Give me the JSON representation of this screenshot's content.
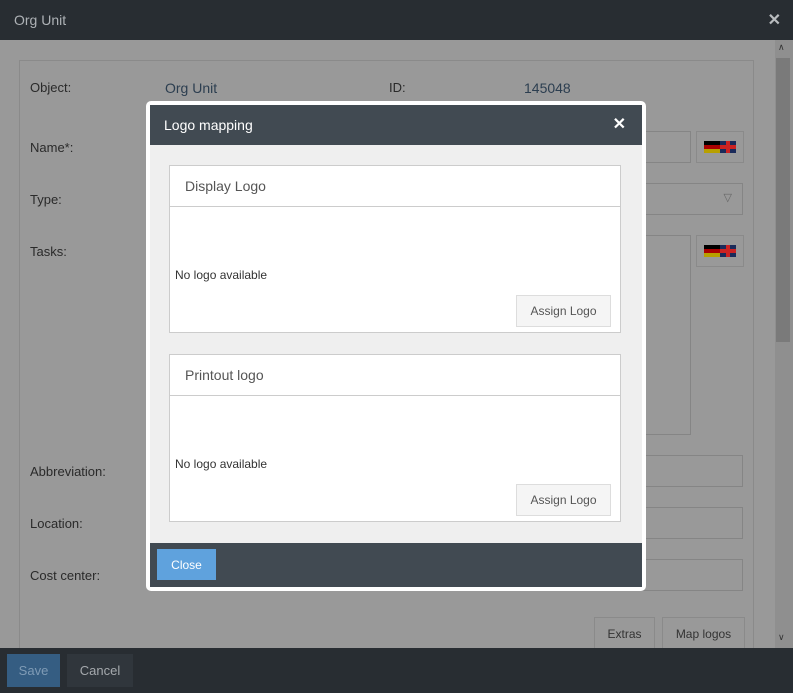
{
  "window": {
    "title": "Org Unit",
    "close_icon": "✕"
  },
  "form": {
    "object_label": "Object:",
    "object_value": "Org Unit",
    "id_label": "ID:",
    "id_value": "145048",
    "name_label": "Name*:",
    "type_label": "Type:",
    "tasks_label": "Tasks:",
    "abbreviation_label": "Abbreviation:",
    "location_label": "Location:",
    "cost_center_label": "Cost center:",
    "extras_label": "Extras",
    "map_logos_label": "Map logos"
  },
  "footer": {
    "save_label": "Save",
    "cancel_label": "Cancel"
  },
  "modal": {
    "title": "Logo mapping",
    "close_icon": "✕",
    "cards": [
      {
        "title": "Display Logo",
        "status": "No logo available",
        "button": "Assign Logo"
      },
      {
        "title": "Printout logo",
        "status": "No logo available",
        "button": "Assign Logo"
      }
    ],
    "close_label": "Close"
  }
}
